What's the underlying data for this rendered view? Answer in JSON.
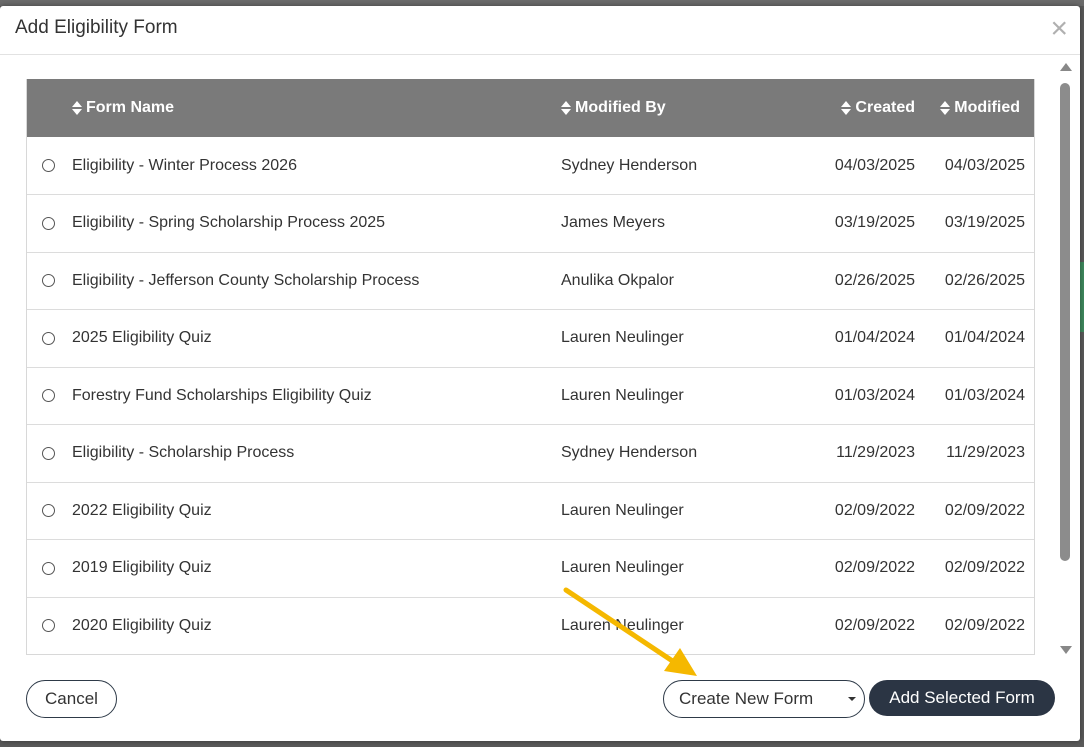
{
  "modal": {
    "title": "Add Eligibility Form",
    "close_symbol": "×"
  },
  "table": {
    "headers": {
      "form_name": "Form Name",
      "modified_by": "Modified By",
      "created": "Created",
      "modified": "Modified"
    },
    "rows": [
      {
        "name": "Eligibility - Winter Process 2026",
        "by": "Sydney Henderson",
        "created": "04/03/2025",
        "modified": "04/03/2025"
      },
      {
        "name": "Eligibility - Spring Scholarship Process 2025",
        "by": "James Meyers",
        "created": "03/19/2025",
        "modified": "03/19/2025"
      },
      {
        "name": "Eligibility - Jefferson County Scholarship Process",
        "by": "Anulika Okpalor",
        "created": "02/26/2025",
        "modified": "02/26/2025"
      },
      {
        "name": "2025 Eligibility Quiz",
        "by": "Lauren Neulinger",
        "created": "01/04/2024",
        "modified": "01/04/2024"
      },
      {
        "name": "Forestry Fund Scholarships Eligibility Quiz",
        "by": "Lauren Neulinger",
        "created": "01/03/2024",
        "modified": "01/03/2024"
      },
      {
        "name": "Eligibility - Scholarship Process",
        "by": "Sydney Henderson",
        "created": "11/29/2023",
        "modified": "11/29/2023"
      },
      {
        "name": "2022 Eligibility Quiz",
        "by": "Lauren Neulinger",
        "created": "02/09/2022",
        "modified": "02/09/2022"
      },
      {
        "name": "2019 Eligibility Quiz",
        "by": "Lauren Neulinger",
        "created": "02/09/2022",
        "modified": "02/09/2022"
      },
      {
        "name": "2020 Eligibility Quiz",
        "by": "Lauren Neulinger",
        "created": "02/09/2022",
        "modified": "02/09/2022"
      }
    ]
  },
  "footer": {
    "cancel_label": "Cancel",
    "create_label": "Create New Form",
    "add_label": "Add Selected Form"
  },
  "colors": {
    "header_bg": "#7a7a7a",
    "primary_button": "#2b3544",
    "annotation_arrow": "#f5b800"
  },
  "icons": [
    "close-icon",
    "sort-icon",
    "radio-icon",
    "caret-down-icon",
    "scroll-up-icon",
    "scroll-down-icon",
    "annotation-arrow-icon"
  ]
}
